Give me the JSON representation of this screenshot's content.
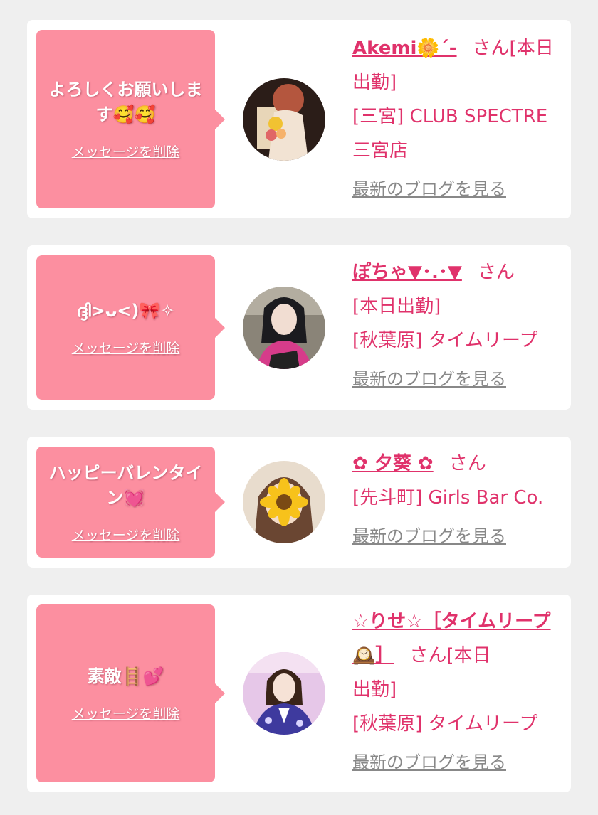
{
  "delete_label": "メッセージを削除",
  "blog_label": "最新のブログを見る",
  "san_label": "さん",
  "colors": {
    "page_bg": "#efefef",
    "card_bg": "#ffffff",
    "bubble_bg": "#fc8fa0",
    "accent": "#e0326b",
    "link_gray": "#888888"
  },
  "cards": [
    {
      "message": "よろしくお願いします🥰🥰",
      "name": "Akemi🌼´-",
      "san_suffix": "[本日",
      "lines": [
        "出勤]",
        "[三宮] CLUB SPECTRE",
        "三宮店"
      ],
      "avatar_icon": "woman-with-flowers-photo"
    },
    {
      "message": "ദ്ദി>ᴗ<)🎀✧",
      "name": "ぽちゃ▼･.･▼",
      "san_suffix": "",
      "lines": [
        "[本日出勤]",
        "[秋葉原] タイムリープ"
      ],
      "avatar_icon": "dark-haired-girl-photo"
    },
    {
      "message": "ハッピーバレンタイン💓",
      "name": "✿ 夕葵 ✿",
      "san_suffix": "",
      "lines": [
        "[先斗町] Girls Bar Co."
      ],
      "avatar_icon": "sunflower-face-photo"
    },
    {
      "message": "素敵🪜💕",
      "name": "☆りせ☆［タイムリープ 🕰️］",
      "san_suffix": "[本日",
      "lines": [
        "出勤]",
        "[秋葉原] タイムリープ"
      ],
      "avatar_icon": "girl-in-kimono-photo"
    }
  ]
}
